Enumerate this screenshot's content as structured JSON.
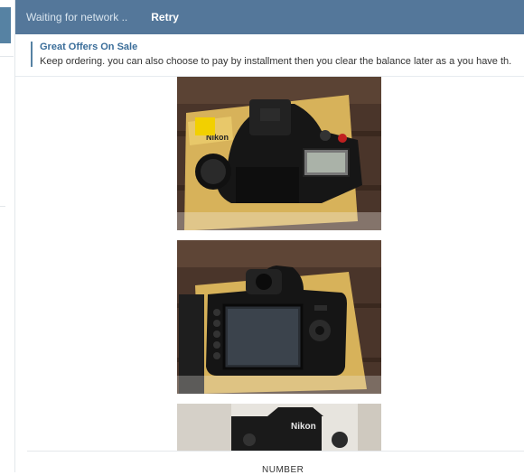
{
  "header": {
    "status_text": "Waiting for network ..",
    "retry_label": "Retry"
  },
  "pinned": {
    "title": "Great Offers On Sale",
    "text": "Keep ordering. you can also choose to pay by installment then you clear the balance later as a you have th."
  },
  "photos": [
    {
      "alt": "camera-top-view",
      "box_brand": "Nikon"
    },
    {
      "alt": "camera-back-view",
      "body_brand": "Nikon"
    },
    {
      "alt": "camera-front-view",
      "brand": "Nikon"
    }
  ],
  "footer": {
    "partial_text": "NUMBER"
  }
}
